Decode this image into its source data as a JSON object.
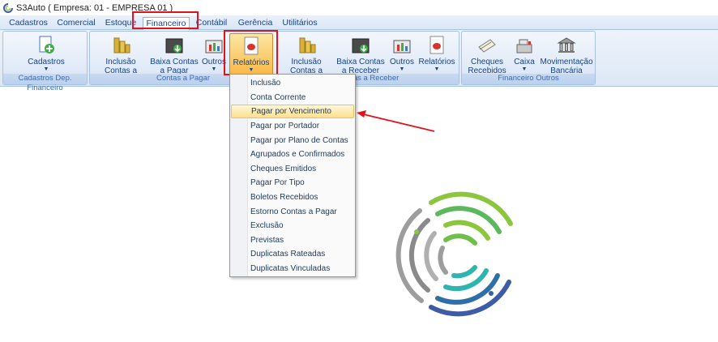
{
  "window": {
    "title": "S3Auto (  Empresa: 01 - EMPRESA 01  )"
  },
  "menu": {
    "tabs": [
      {
        "label": "Cadastros"
      },
      {
        "label": "Comercial"
      },
      {
        "label": "Estoque"
      },
      {
        "label": "Financeiro",
        "active": true
      },
      {
        "label": "Contábil"
      },
      {
        "label": "Gerência"
      },
      {
        "label": "Utilitários"
      }
    ]
  },
  "ribbon": {
    "groups": [
      {
        "label": "Cadastros Dep. Financeiro",
        "buttons": [
          {
            "label": "Cadastros",
            "icon": "add-document-icon"
          }
        ]
      },
      {
        "label": "Contas a Pagar",
        "buttons": [
          {
            "label": "Inclusão Contas a Pagar",
            "icon": "coins-icon"
          },
          {
            "label": "Baixa Contas a Pagar",
            "icon": "safe-download-icon"
          },
          {
            "label": "Outros",
            "icon": "folder-chart-icon"
          },
          {
            "label": "Relatórios",
            "icon": "report-icon"
          }
        ]
      },
      {
        "label": "Contas a Receber",
        "buttons": [
          {
            "label": "Inclusão Contas a Receber",
            "icon": "coins-icon"
          },
          {
            "label": "Baixa Contas a Receber",
            "icon": "safe-download-icon"
          },
          {
            "label": "Outros",
            "icon": "folder-chart-icon"
          },
          {
            "label": "Relatórios",
            "icon": "report-icon"
          }
        ]
      },
      {
        "label": "Financeiro Outros",
        "buttons": [
          {
            "label": "Cheques Recebidos",
            "icon": "cheques-icon"
          },
          {
            "label": "Caixa",
            "icon": "cash-register-icon"
          },
          {
            "label": "Movimentação Bancária",
            "icon": "bank-icon"
          }
        ]
      }
    ]
  },
  "dropdown": {
    "items": [
      "Inclusão",
      "Conta Corrente",
      "Pagar por Vencimento",
      "Pagar por Portador",
      "Pagar por Plano de Contas",
      "Agrupados e Confirmados",
      "Cheques Emitidos",
      "Pagar Por Tipo",
      "Boletos Recebidos",
      "Estorno Contas a Pagar",
      "Exclusão",
      "Previstas",
      "Duplicatas Rateadas",
      "Duplicatas Vinculadas"
    ],
    "highlighted": "Pagar por Vencimento"
  },
  "colors": {
    "annotation": "#e0141d",
    "accent": "#15428b",
    "logo_green": "#8cc63f",
    "logo_teal": "#2fb5b0",
    "logo_gray": "#9d9d9d",
    "logo_blue": "#3e5ba8"
  }
}
